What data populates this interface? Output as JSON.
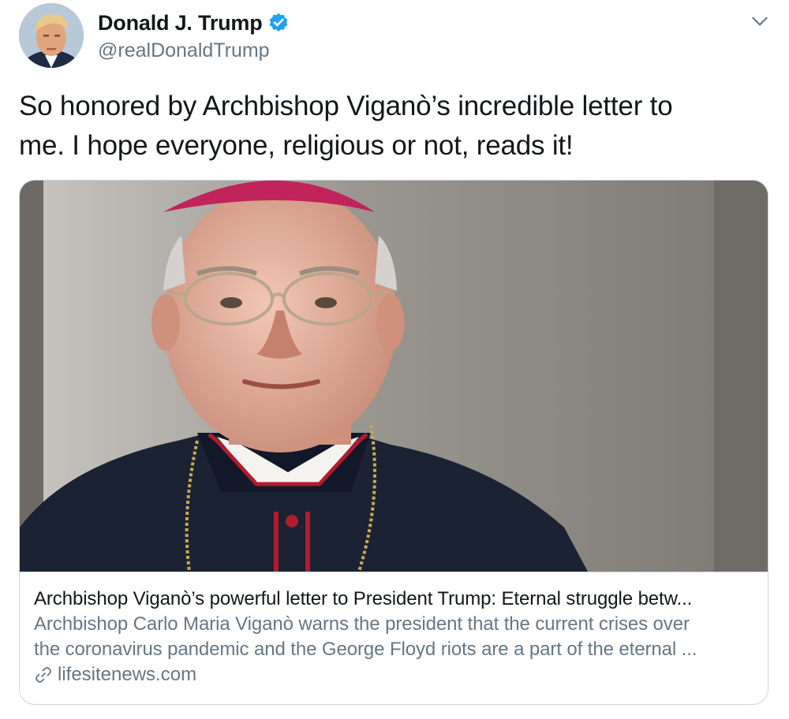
{
  "tweet": {
    "author": {
      "display_name": "Donald J. Trump",
      "handle": "@realDonaldTrump",
      "verified": true,
      "verified_icon": "verified-badge-icon"
    },
    "menu_icon": "chevron-down-icon",
    "text_lines": [
      "So honored by Archbishop Viganò’s incredible letter to",
      "me. I hope everyone, religious or not, reads it!"
    ]
  },
  "link_card": {
    "title": "Archbishop Viganò’s powerful letter to President Trump: Eternal struggle betw...",
    "description_lines": [
      "Archbishop Carlo Maria Viganò warns the president that the current crises over",
      "the coronavirus pandemic and the George Floyd riots are a part of the eternal ..."
    ],
    "domain": "lifesitenews.com",
    "domain_icon": "link-icon"
  },
  "colors": {
    "text_primary": "#14171a",
    "text_secondary": "#657786",
    "verified_blue": "#1da1f2",
    "card_border": "#ccd6dd"
  }
}
